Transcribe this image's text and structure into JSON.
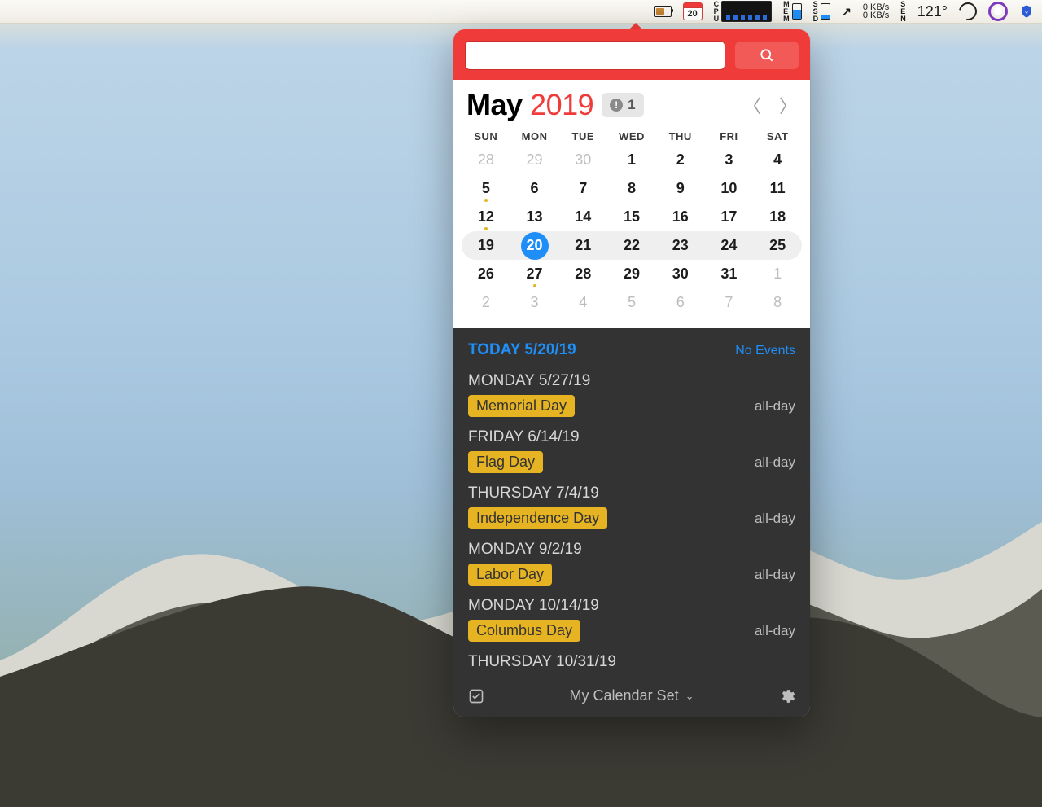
{
  "menubar": {
    "calendar_day": "20",
    "cpu_label": "CPU",
    "mem_label": "MEM",
    "ssd_label": "SSD",
    "sen_label": "SEN",
    "net_up": "0 KB/s",
    "net_down": "0 KB/s",
    "temperature": "121°",
    "arrows": "↗"
  },
  "search": {
    "placeholder": ""
  },
  "header": {
    "month": "May",
    "year": "2019",
    "alert_count": "1"
  },
  "dow": [
    "SUN",
    "MON",
    "TUE",
    "WED",
    "THU",
    "FRI",
    "SAT"
  ],
  "weeks": [
    {
      "current": false,
      "days": [
        {
          "n": "28",
          "other": true
        },
        {
          "n": "29",
          "other": true
        },
        {
          "n": "30",
          "other": true
        },
        {
          "n": "1"
        },
        {
          "n": "2"
        },
        {
          "n": "3"
        },
        {
          "n": "4"
        }
      ]
    },
    {
      "current": false,
      "days": [
        {
          "n": "5",
          "dot": true
        },
        {
          "n": "6"
        },
        {
          "n": "7"
        },
        {
          "n": "8"
        },
        {
          "n": "9"
        },
        {
          "n": "10"
        },
        {
          "n": "11"
        }
      ]
    },
    {
      "current": false,
      "days": [
        {
          "n": "12",
          "dot": true
        },
        {
          "n": "13"
        },
        {
          "n": "14"
        },
        {
          "n": "15"
        },
        {
          "n": "16"
        },
        {
          "n": "17"
        },
        {
          "n": "18"
        }
      ]
    },
    {
      "current": true,
      "days": [
        {
          "n": "19"
        },
        {
          "n": "20",
          "today": true
        },
        {
          "n": "21"
        },
        {
          "n": "22"
        },
        {
          "n": "23"
        },
        {
          "n": "24"
        },
        {
          "n": "25"
        }
      ]
    },
    {
      "current": false,
      "days": [
        {
          "n": "26"
        },
        {
          "n": "27",
          "dot": true
        },
        {
          "n": "28"
        },
        {
          "n": "29"
        },
        {
          "n": "30"
        },
        {
          "n": "31"
        },
        {
          "n": "1",
          "other": true
        }
      ]
    },
    {
      "current": false,
      "days": [
        {
          "n": "2",
          "other": true
        },
        {
          "n": "3",
          "other": true
        },
        {
          "n": "4",
          "other": true
        },
        {
          "n": "5",
          "other": true
        },
        {
          "n": "6",
          "other": true
        },
        {
          "n": "7",
          "other": true
        },
        {
          "n": "8",
          "other": true
        }
      ]
    }
  ],
  "agenda": {
    "today_label": "TODAY 5/20/19",
    "no_events": "No Events",
    "groups": [
      {
        "date": "MONDAY 5/27/19",
        "events": [
          {
            "title": "Memorial Day",
            "time": "all-day"
          }
        ]
      },
      {
        "date": "FRIDAY 6/14/19",
        "events": [
          {
            "title": "Flag Day",
            "time": "all-day"
          }
        ]
      },
      {
        "date": "THURSDAY 7/4/19",
        "events": [
          {
            "title": "Independence Day",
            "time": "all-day"
          }
        ]
      },
      {
        "date": "MONDAY 9/2/19",
        "events": [
          {
            "title": "Labor Day",
            "time": "all-day"
          }
        ]
      },
      {
        "date": "MONDAY 10/14/19",
        "events": [
          {
            "title": "Columbus Day",
            "time": "all-day"
          }
        ]
      },
      {
        "date": "THURSDAY 10/31/19",
        "events": []
      }
    ]
  },
  "footer": {
    "calendar_set": "My Calendar Set"
  },
  "colors": {
    "accent_red": "#ef3b39",
    "accent_blue": "#1f8ef6",
    "event_yellow": "#e6b323",
    "panel_dark": "#333333"
  }
}
